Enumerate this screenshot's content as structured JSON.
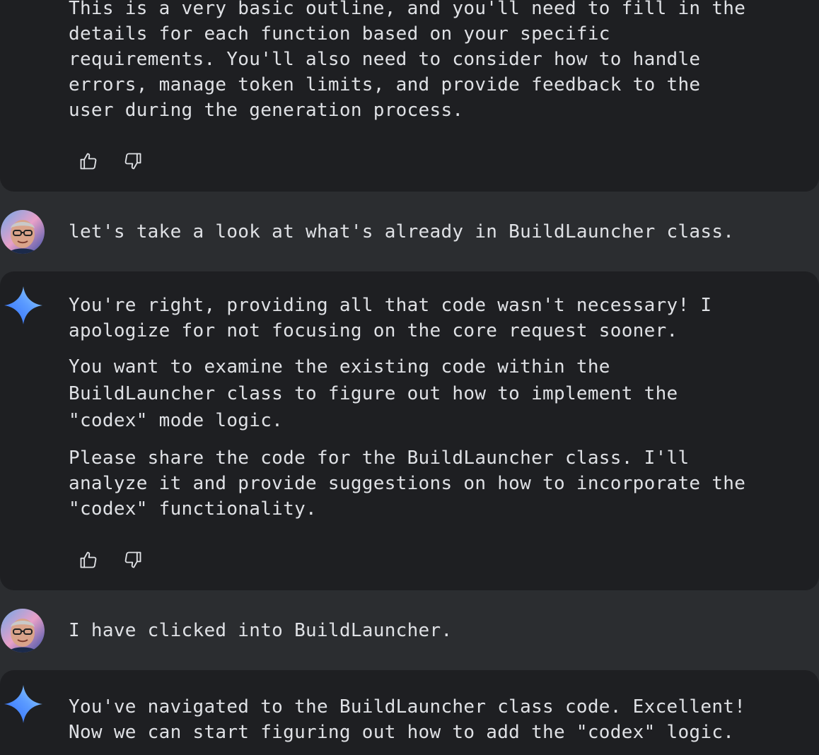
{
  "conversation": {
    "m1": {
      "role": "assistant",
      "lines": [
        "This is a very basic outline, and you'll need to fill in the",
        "details for each function based on your specific",
        "requirements. You'll also need to consider how to handle",
        "errors, manage token limits, and provide feedback to the",
        "user during the generation process."
      ]
    },
    "m2": {
      "role": "user",
      "text": "let's take a look at what's already in BuildLauncher class."
    },
    "m3": {
      "role": "assistant",
      "p1": [
        "You're right, providing all that code wasn't necessary! I",
        "apologize for not focusing on the core request sooner."
      ],
      "p2": [
        "You want to examine the existing code within the",
        "BuildLauncher class to figure out how to implement the",
        "\"codex\" mode logic."
      ],
      "p3": [
        "Please share the code for the BuildLauncher class. I'll",
        "analyze it and provide suggestions on how to incorporate the",
        "\"codex\" functionality."
      ]
    },
    "m4": {
      "role": "user",
      "text": "I have clicked into BuildLauncher."
    },
    "m5": {
      "role": "assistant",
      "lines": [
        "You've navigated to the BuildLauncher class code. Excellent!",
        "Now we can start figuring out how to add the \"codex\" logic."
      ]
    }
  },
  "icons": {
    "thumbs_up": "thumbs-up-icon",
    "thumbs_down": "thumbs-down-icon",
    "assistant": "sparkle-icon",
    "user": "user-avatar"
  },
  "colors": {
    "background": "#2b2d30",
    "card": "#1e1f22",
    "text": "#dfe1e5",
    "sparkle_start": "#4f8cff",
    "sparkle_end": "#8fd3ff"
  }
}
